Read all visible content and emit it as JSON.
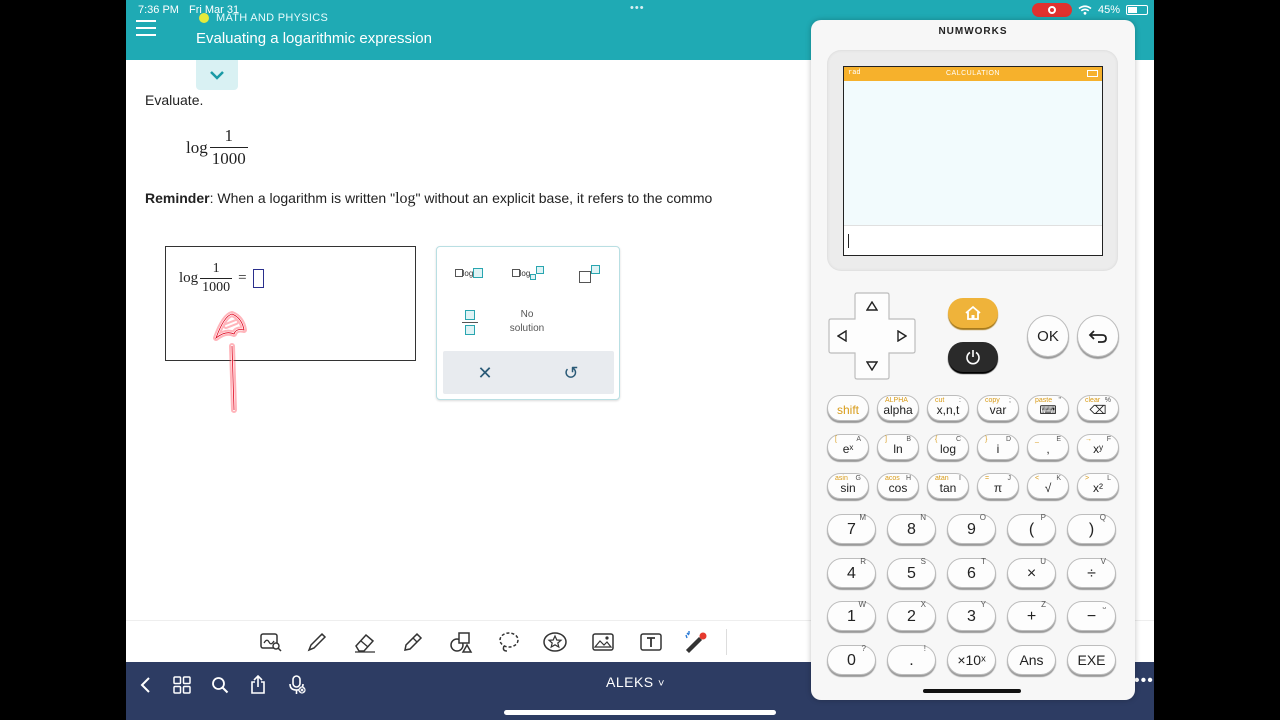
{
  "status_bar": {
    "time": "7:36 PM",
    "date": "Fri Mar 31",
    "battery": "45%"
  },
  "header": {
    "topic": "MATH AND PHYSICS",
    "title": "Evaluating a logarithmic expression"
  },
  "problem": {
    "instruction": "Evaluate.",
    "log": "log",
    "numerator": "1",
    "denominator": "1000",
    "reminder_label": "Reminder",
    "reminder_before": ": When a logarithm is written \"",
    "reminder_log": "log",
    "reminder_after": "\" without an explicit base, it refers to the commo",
    "equals": "="
  },
  "palette": {
    "log_label": "log",
    "no_solution_line1": "No",
    "no_solution_line2": "solution",
    "clear_symbol": "✕",
    "undo_symbol": "↺"
  },
  "bottom_nav": {
    "app_name": "ALEKS",
    "chevron": "˅",
    "more": "•••"
  },
  "calculator": {
    "brand": "NUMWORKS",
    "angle_mode": "rad",
    "app_title": "CALCULATION",
    "ok_label": "OK",
    "rows": [
      [
        {
          "main": "shift",
          "sec": "",
          "alp": "",
          "main_color": "#d89b18"
        },
        {
          "main": "alpha",
          "sec": "ALPHA",
          "alp": ""
        },
        {
          "main": "x,n,t",
          "sec": "cut",
          "alp": ":"
        },
        {
          "main": "var",
          "sec": "copy",
          "alp": ";"
        },
        {
          "main": "⌨",
          "sec": "paste",
          "alp": "\""
        },
        {
          "main": "⌫",
          "sec": "clear",
          "alp": "%"
        }
      ],
      [
        {
          "main": "eˣ",
          "sec": "[",
          "alp": "A"
        },
        {
          "main": "ln",
          "sec": "]",
          "alp": "B"
        },
        {
          "main": "log",
          "sec": "{",
          "alp": "C"
        },
        {
          "main": "i",
          "sec": "}",
          "alp": "D"
        },
        {
          "main": ",",
          "sec": "_",
          "alp": "E"
        },
        {
          "main": "xʸ",
          "sec": "→",
          "alp": "F"
        }
      ],
      [
        {
          "main": "sin",
          "sec": "asin",
          "alp": "G"
        },
        {
          "main": "cos",
          "sec": "acos",
          "alp": "H"
        },
        {
          "main": "tan",
          "sec": "atan",
          "alp": "I"
        },
        {
          "main": "π",
          "sec": "=",
          "alp": "J"
        },
        {
          "main": "√",
          "sec": "<",
          "alp": "K"
        },
        {
          "main": "x²",
          "sec": ">",
          "alp": "L"
        }
      ]
    ],
    "num_rows": [
      [
        {
          "main": "7",
          "alp": "M"
        },
        {
          "main": "8",
          "alp": "N"
        },
        {
          "main": "9",
          "alp": "O"
        },
        {
          "main": "(",
          "alp": "P"
        },
        {
          "main": ")",
          "alp": "Q"
        }
      ],
      [
        {
          "main": "4",
          "alp": "R"
        },
        {
          "main": "5",
          "alp": "S"
        },
        {
          "main": "6",
          "alp": "T"
        },
        {
          "main": "×",
          "alp": "U"
        },
        {
          "main": "÷",
          "alp": "V"
        }
      ],
      [
        {
          "main": "1",
          "alp": "W"
        },
        {
          "main": "2",
          "alp": "X"
        },
        {
          "main": "3",
          "alp": "Y"
        },
        {
          "main": "+",
          "alp": "Z"
        },
        {
          "main": "−",
          "alp": "⎵"
        }
      ],
      [
        {
          "main": "0",
          "alp": "?"
        },
        {
          "main": ".",
          "alp": "!"
        },
        {
          "main": "×10ˣ",
          "alp": ""
        },
        {
          "main": "Ans",
          "alp": ""
        },
        {
          "main": "EXE",
          "alp": ""
        }
      ]
    ]
  }
}
